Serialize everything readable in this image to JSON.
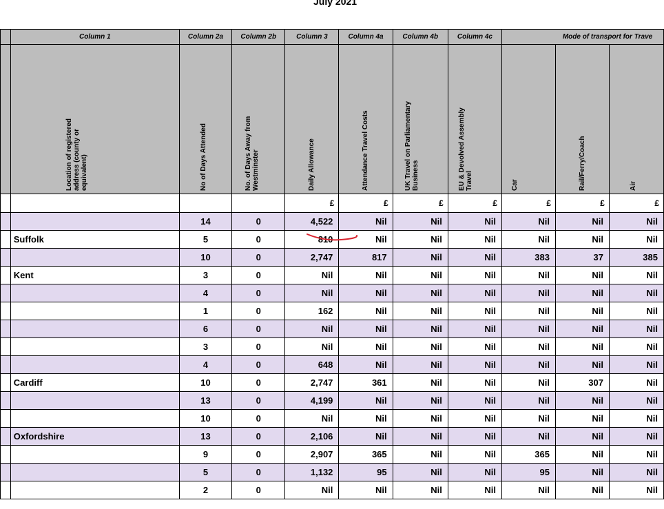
{
  "title": "July 2021",
  "column_labels": {
    "c1": "Column 1",
    "c2a": "Column 2a",
    "c2b": "Column 2b",
    "c3": "Column 3",
    "c4a": "Column 4a",
    "c4b": "Column 4b",
    "c4c": "Column 4c",
    "mode": "Mode of transport for Trave"
  },
  "headers": {
    "location": "Location of registered address (county or equivalent)",
    "days_attended": "No of Days Attended",
    "days_away": "No. of Days Away from Westminster",
    "daily_allowance": "Daily Allowance",
    "attendance_travel": "Attendance Travel Costs",
    "uk_travel": "UK Travel on Parliamentary Business",
    "eu_travel": "EU & Devolved Assembly Travel",
    "car": "Car",
    "rail": "Rail/Ferry/Coach",
    "air": "Air"
  },
  "currency_symbol": "£",
  "rows": [
    {
      "loc": "",
      "d": "14",
      "a": "0",
      "da": "4,522",
      "at": "Nil",
      "uk": "Nil",
      "eu": "Nil",
      "car": "Nil",
      "rail": "Nil",
      "air": "Nil"
    },
    {
      "loc": "Suffolk",
      "d": "5",
      "a": "0",
      "da": "810",
      "at": "Nil",
      "uk": "Nil",
      "eu": "Nil",
      "car": "Nil",
      "rail": "Nil",
      "air": "Nil"
    },
    {
      "loc": "",
      "d": "10",
      "a": "0",
      "da": "2,747",
      "at": "817",
      "uk": "Nil",
      "eu": "Nil",
      "car": "383",
      "rail": "37",
      "air": "385"
    },
    {
      "loc": "Kent",
      "d": "3",
      "a": "0",
      "da": "Nil",
      "at": "Nil",
      "uk": "Nil",
      "eu": "Nil",
      "car": "Nil",
      "rail": "Nil",
      "air": "Nil"
    },
    {
      "loc": "",
      "d": "4",
      "a": "0",
      "da": "Nil",
      "at": "Nil",
      "uk": "Nil",
      "eu": "Nil",
      "car": "Nil",
      "rail": "Nil",
      "air": "Nil"
    },
    {
      "loc": "",
      "d": "1",
      "a": "0",
      "da": "162",
      "at": "Nil",
      "uk": "Nil",
      "eu": "Nil",
      "car": "Nil",
      "rail": "Nil",
      "air": "Nil"
    },
    {
      "loc": "",
      "d": "6",
      "a": "0",
      "da": "Nil",
      "at": "Nil",
      "uk": "Nil",
      "eu": "Nil",
      "car": "Nil",
      "rail": "Nil",
      "air": "Nil"
    },
    {
      "loc": "",
      "d": "3",
      "a": "0",
      "da": "Nil",
      "at": "Nil",
      "uk": "Nil",
      "eu": "Nil",
      "car": "Nil",
      "rail": "Nil",
      "air": "Nil"
    },
    {
      "loc": "",
      "d": "4",
      "a": "0",
      "da": "648",
      "at": "Nil",
      "uk": "Nil",
      "eu": "Nil",
      "car": "Nil",
      "rail": "Nil",
      "air": "Nil"
    },
    {
      "loc": "Cardiff",
      "d": "10",
      "a": "0",
      "da": "2,747",
      "at": "361",
      "uk": "Nil",
      "eu": "Nil",
      "car": "Nil",
      "rail": "307",
      "air": "Nil"
    },
    {
      "loc": "",
      "d": "13",
      "a": "0",
      "da": "4,199",
      "at": "Nil",
      "uk": "Nil",
      "eu": "Nil",
      "car": "Nil",
      "rail": "Nil",
      "air": "Nil"
    },
    {
      "loc": "",
      "d": "10",
      "a": "0",
      "da": "Nil",
      "at": "Nil",
      "uk": "Nil",
      "eu": "Nil",
      "car": "Nil",
      "rail": "Nil",
      "air": "Nil"
    },
    {
      "loc": "Oxfordshire",
      "d": "13",
      "a": "0",
      "da": "2,106",
      "at": "Nil",
      "uk": "Nil",
      "eu": "Nil",
      "car": "Nil",
      "rail": "Nil",
      "air": "Nil"
    },
    {
      "loc": "",
      "d": "9",
      "a": "0",
      "da": "2,907",
      "at": "365",
      "uk": "Nil",
      "eu": "Nil",
      "car": "365",
      "rail": "Nil",
      "air": "Nil"
    },
    {
      "loc": "",
      "d": "5",
      "a": "0",
      "da": "1,132",
      "at": "95",
      "uk": "Nil",
      "eu": "Nil",
      "car": "95",
      "rail": "Nil",
      "air": "Nil"
    },
    {
      "loc": "",
      "d": "2",
      "a": "0",
      "da": "Nil",
      "at": "Nil",
      "uk": "Nil",
      "eu": "Nil",
      "car": "Nil",
      "rail": "Nil",
      "air": "Nil"
    }
  ],
  "colors": {
    "header_gray": "#bdbdbd",
    "row_shade": "#e2d9ef",
    "annotation_red": "#d9232e"
  }
}
